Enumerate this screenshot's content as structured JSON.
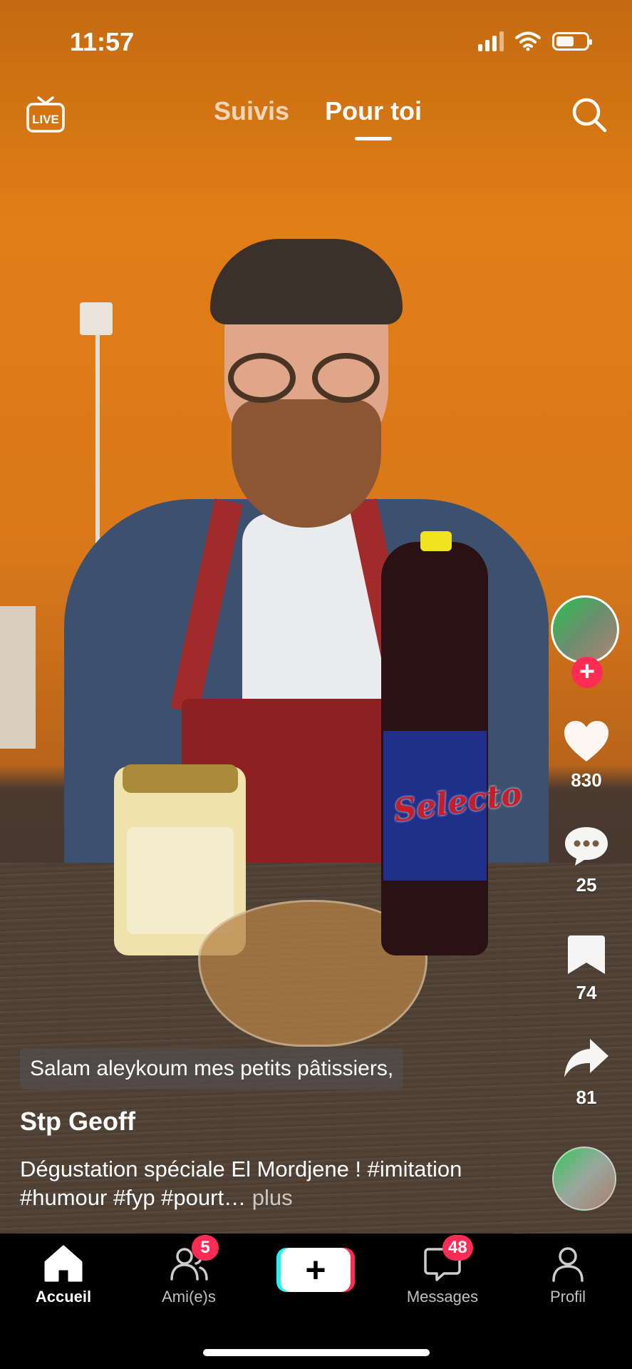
{
  "status_bar": {
    "time": "11:57"
  },
  "top_nav": {
    "live_label": "LIVE",
    "tabs": [
      {
        "label": "Suivis",
        "active": false
      },
      {
        "label": "Pour toi",
        "active": true
      }
    ],
    "icons": {
      "live": "live-tv-icon",
      "search": "search-icon"
    }
  },
  "video": {
    "caption_overlay": "Salam aleykoum mes petits pâtissiers,",
    "author": "Stp Geoff",
    "description": "Dégustation spéciale El Mordjene ! #imitation #humour #fyp #pourt…",
    "more_label": "plus",
    "product_text": "Selecto"
  },
  "side_actions": {
    "likes": "830",
    "comments": "25",
    "saves": "74",
    "shares": "81",
    "follow_symbol": "+"
  },
  "bottom_nav": {
    "items": [
      {
        "label": "Accueil",
        "icon": "home-icon",
        "active": true
      },
      {
        "label": "Ami(e)s",
        "icon": "friends-icon",
        "badge": "5"
      },
      {
        "label": "",
        "icon": "create-plus-icon"
      },
      {
        "label": "Messages",
        "icon": "messages-icon",
        "badge": "48"
      },
      {
        "label": "Profil",
        "icon": "profile-icon"
      }
    ],
    "create_symbol": "+"
  },
  "colors": {
    "accent_red": "#fe2c55",
    "accent_cyan": "#25f4ee",
    "background_orange": "#e17e17"
  }
}
